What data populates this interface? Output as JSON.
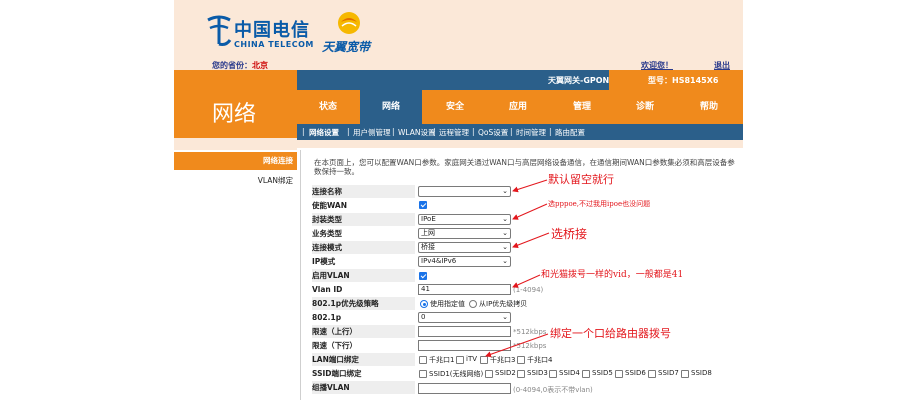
{
  "header": {
    "brand_cn": "中国电信",
    "brand_en": "CHINA TELECOM",
    "product": "天翼宽带",
    "province_label": "您的省份：",
    "province_value": "北京",
    "welcome": "欢迎您！",
    "logout": "退出"
  },
  "device": {
    "gateway": "天翼网关-GPON",
    "model": "型号：HS8145X6"
  },
  "section": {
    "title": "网络"
  },
  "nav": {
    "items": [
      {
        "label": "状态"
      },
      {
        "label": "网络"
      },
      {
        "label": "安全"
      },
      {
        "label": "应用"
      },
      {
        "label": "管理"
      },
      {
        "label": "诊断"
      },
      {
        "label": "帮助"
      }
    ]
  },
  "subnav": {
    "items": [
      {
        "label": "网络设置"
      },
      {
        "label": "用户侧管理"
      },
      {
        "label": "WLAN设置"
      },
      {
        "label": "远程管理"
      },
      {
        "label": "QoS设置"
      },
      {
        "label": "时间管理"
      },
      {
        "label": "路由配置"
      }
    ]
  },
  "leftmenu": {
    "items": [
      {
        "label": "网络连接"
      },
      {
        "label": "VLAN绑定"
      }
    ]
  },
  "main": {
    "description": "在本页面上，您可以配置WAN口参数。家庭网关通过WAN口与高层网络设备通信，在通信期间WAN口参数集必须和高层设备参数保持一致。",
    "labels": {
      "conn_name": "连接名称",
      "enable_wan": "使能WAN",
      "encap": "封装类型",
      "service": "业务类型",
      "conn_mode": "连接模式",
      "ip_mode": "IP模式",
      "enable_vlan": "启用VLAN",
      "vlan_id": "Vlan ID",
      "priority_policy": "802.1p优先级策略",
      "p8021": "802.1p",
      "up_limit": "限速（上行）",
      "down_limit": "限速（下行）",
      "lan_bind": "LAN端口绑定",
      "ssid_bind": "SSID端口绑定",
      "mcast_vlan": "组播VLAN"
    },
    "values": {
      "conn_name": "",
      "encap": "IPoE",
      "service": "上网",
      "conn_mode": "桥接",
      "ip_mode": "IPv4&IPv6",
      "vlan_id": "41",
      "vlan_hint": "(1-4094)",
      "policy_opt1": "使用指定值",
      "policy_opt2": "从IP优先级拷贝",
      "p8021": "0",
      "up_hint": "*512kbps",
      "down_hint": "*512kbps",
      "mcast_hint": "(0-4094,0表示不带vlan)"
    },
    "lan_ports": [
      "千兆口1",
      "iTV",
      "千兆口3",
      "千兆口4"
    ],
    "ssids": [
      "SSID1(无线网络)",
      "SSID2",
      "SSID3",
      "SSID4",
      "SSID5",
      "SSID6",
      "SSID7",
      "SSID8"
    ]
  },
  "annotations": {
    "a1": "默认留空就行",
    "a2": "选pppoe,不过我用ipoe也没问题",
    "a3": "选桥接",
    "a4": "和光猫拨号一样的vid，一般都是41",
    "a5": "绑定一个口给路由器拨号"
  },
  "colors": {
    "orange": "#f08a1c",
    "blue": "#2b5f8a",
    "annotation_red": "#e3171d"
  }
}
